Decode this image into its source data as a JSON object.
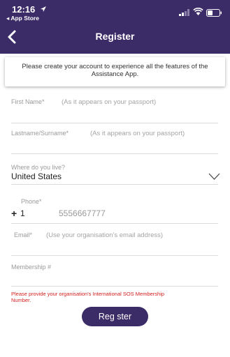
{
  "status_bar": {
    "time": "12:16",
    "back_to_app": "◂ App Store"
  },
  "header": {
    "title": "Register"
  },
  "notice": {
    "text": "Please create your account to experience all the features of the Assistance App."
  },
  "form": {
    "first_name": {
      "label": "First Name*",
      "hint": "(As it appears on your passport)"
    },
    "last_name": {
      "label": "Lastname/Surname*",
      "hint": "(As it appears on your passport)"
    },
    "country": {
      "label": "Where do you live?",
      "value": "United States"
    },
    "phone": {
      "label": "Phone*",
      "plus": "+",
      "code": "1",
      "placeholder": "5556667777"
    },
    "email": {
      "label": "Email*",
      "hint": "(Use your organisation's email address)"
    },
    "membership": {
      "label": "Membership #"
    }
  },
  "error": {
    "text": "Please provide your organisation's International SOS Membership Number."
  },
  "register_button": {
    "label": "Reg ster"
  },
  "colors": {
    "header_bg": "#3b2b66",
    "error": "#d31f1f"
  }
}
